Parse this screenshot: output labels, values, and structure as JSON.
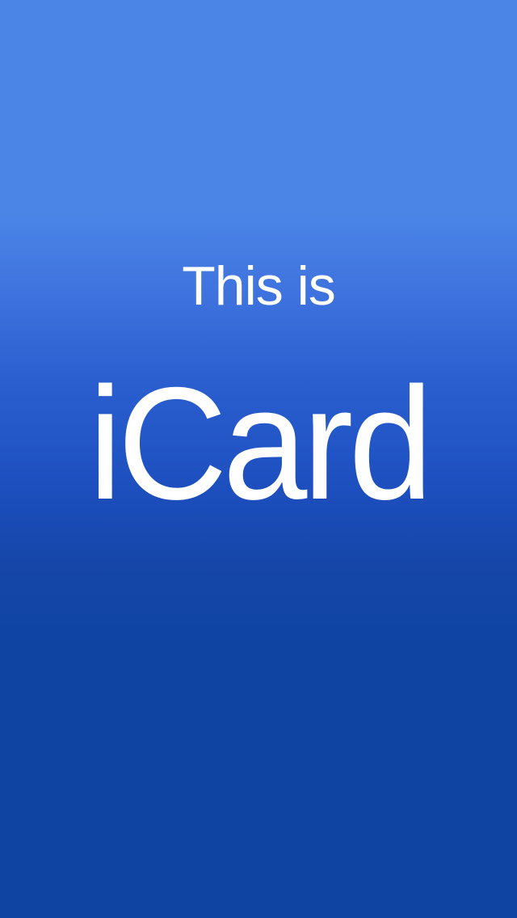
{
  "splash": {
    "intro_text": "This is",
    "app_name": "iCard"
  },
  "colors": {
    "background_top": "#4b86e7",
    "background_bottom": "#0f44a3",
    "text": "#ffffff"
  }
}
